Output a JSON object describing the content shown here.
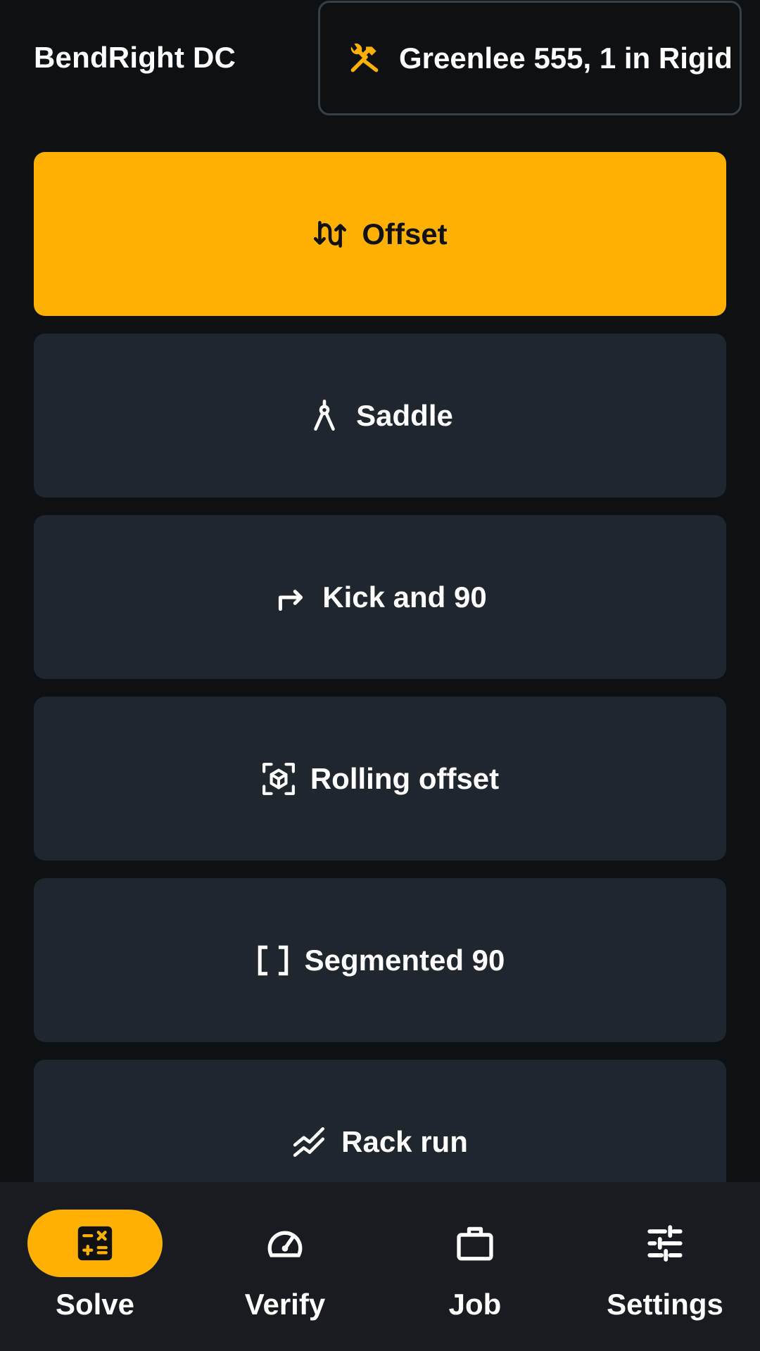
{
  "app": {
    "title": "BendRight DC",
    "accent": "#ffb000"
  },
  "bender": {
    "label": "Greenlee 555, 1 in Rigid",
    "icon": "tools-icon"
  },
  "calculators": [
    {
      "label": "Offset",
      "icon": "offset-arrows-icon",
      "selected": true
    },
    {
      "label": "Saddle",
      "icon": "compass-icon",
      "selected": false
    },
    {
      "label": "Kick and 90",
      "icon": "turn-right-arrow-icon",
      "selected": false
    },
    {
      "label": "Rolling offset",
      "icon": "3d-box-icon",
      "selected": false
    },
    {
      "label": "Segmented 90",
      "icon": "brackets-icon",
      "selected": false
    },
    {
      "label": "Rack run",
      "icon": "zigzag-lines-icon",
      "selected": false
    }
  ],
  "nav": [
    {
      "label": "Solve",
      "icon": "calculator-icon",
      "active": true
    },
    {
      "label": "Verify",
      "icon": "gauge-icon",
      "active": false
    },
    {
      "label": "Job",
      "icon": "briefcase-icon",
      "active": false
    },
    {
      "label": "Settings",
      "icon": "sliders-icon",
      "active": false
    }
  ]
}
